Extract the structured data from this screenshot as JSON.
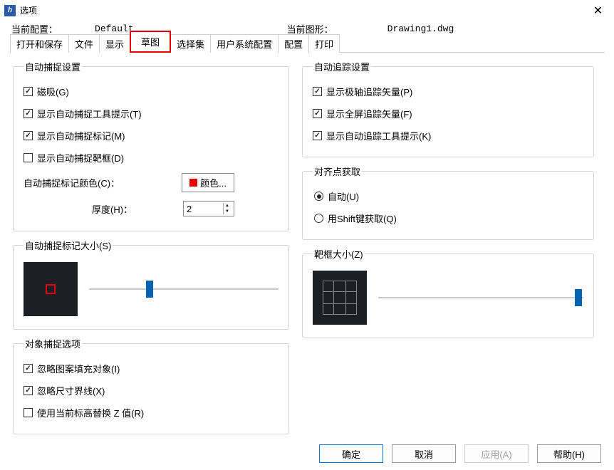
{
  "window": {
    "title": "选项"
  },
  "header": {
    "current_config_label": "当前配置：",
    "current_config_value": "Default",
    "current_drawing_label": "当前图形：",
    "current_drawing_value": "Drawing1.dwg"
  },
  "tabs": {
    "open_save": "打开和保存",
    "file": "文件",
    "display": "显示",
    "draft": "草图",
    "select_set": "选择集",
    "user_sys": "用户系统配置",
    "config": "配置",
    "print": "打印"
  },
  "autosnap": {
    "legend": "自动捕捉设置",
    "magnetic": "磁吸(G)",
    "show_tooltip": "显示自动捕捉工具提示(T)",
    "show_marker": "显示自动捕捉标记(M)",
    "show_aperture": "显示自动捕捉靶框(D)",
    "marker_color_label": "自动捕捉标记颜色(C)：",
    "color_btn": "颜色...",
    "thickness_label": "厚度(H)：",
    "thickness_value": "2"
  },
  "autotrack": {
    "legend": "自动追踪设置",
    "polar_vector": "显示极轴追踪矢量(P)",
    "fullscreen_vector": "显示全屏追踪矢量(F)",
    "track_tooltip": "显示自动追踪工具提示(K)"
  },
  "align_point": {
    "legend": "对齐点获取",
    "auto": "自动(U)",
    "shift": "用Shift键获取(Q)"
  },
  "marker_size": {
    "legend": "自动捕捉标记大小(S)"
  },
  "aperture_size": {
    "legend": "靶框大小(Z)"
  },
  "object_snap": {
    "legend": "对象捕捉选项",
    "ignore_hatch": "忽略图案填充对象(I)",
    "ignore_dim": "忽略尺寸界线(X)",
    "use_elevation": "使用当前标高替换 Z 值(R)"
  },
  "buttons": {
    "ok": "确定",
    "cancel": "取消",
    "apply": "应用(A)",
    "help": "帮助(H)"
  }
}
